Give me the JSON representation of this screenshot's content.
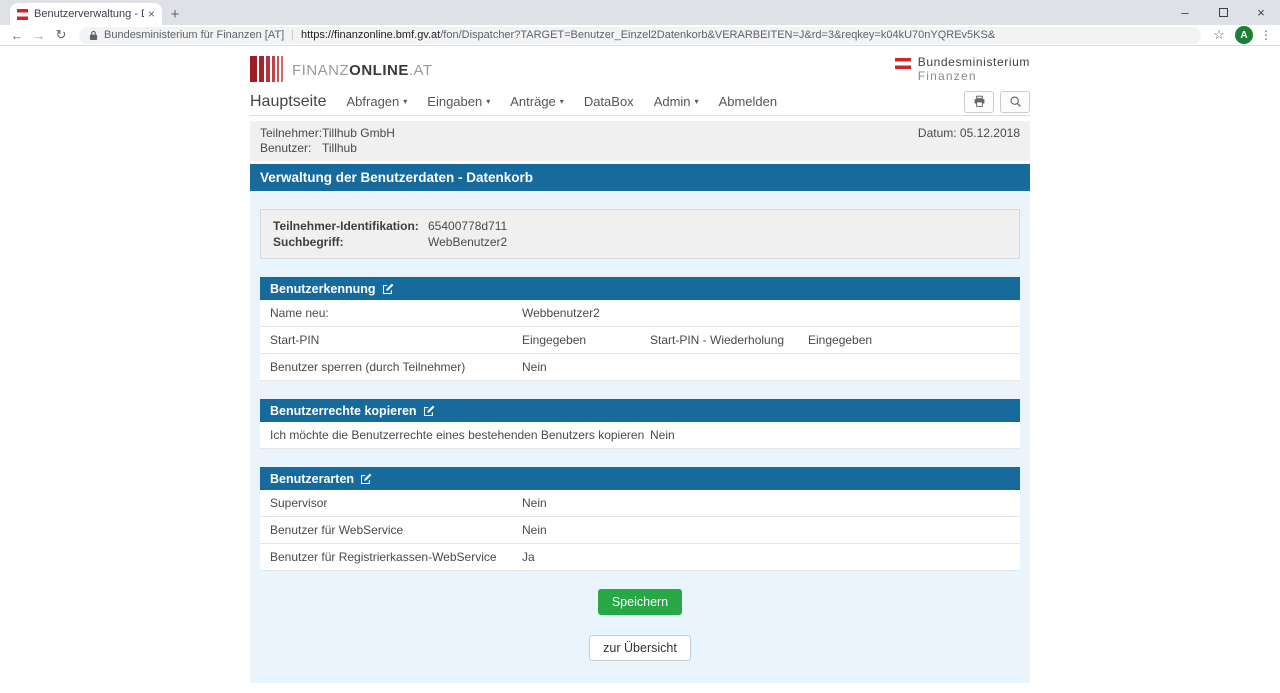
{
  "icons": {
    "back": "←",
    "forward": "→",
    "reload": "↻",
    "star": "☆",
    "menu": "⋮",
    "minimize": "–",
    "close": "×",
    "tab_close": "×",
    "new_tab": "+",
    "caret": "▾"
  },
  "browser": {
    "tab_title": "Benutzerverwaltung - Datenkorb",
    "address": {
      "security_label": "Bundesministerium für Finanzen [AT]",
      "url_domain": "https://finanzonline.bmf.gv.at",
      "url_path": "/fon/Dispatcher?TARGET=Benutzer_Einzel2Datenkorb&VERARBEITEN=J&rd=3&reqkey=k04kU70nYQREv5KS&",
      "avatar_letter": "A"
    }
  },
  "header": {
    "logo_finanz": "FINANZ",
    "logo_online": "ONLINE",
    "logo_at": ".AT",
    "ministry_line1": "Bundesministerium",
    "ministry_line2": "Finanzen"
  },
  "nav": {
    "items": [
      {
        "label": "Hauptseite"
      },
      {
        "label": "Abfragen"
      },
      {
        "label": "Eingaben"
      },
      {
        "label": "Anträge"
      },
      {
        "label": "DataBox"
      },
      {
        "label": "Admin"
      },
      {
        "label": "Abmelden"
      }
    ]
  },
  "session": {
    "teilnehmer_label": "Teilnehmer:",
    "teilnehmer_value": "Tillhub GmbH",
    "benutzer_label": "Benutzer:",
    "benutzer_value": "Tillhub",
    "date": "Datum: 05.12.2018"
  },
  "page": {
    "title": "Verwaltung der Benutzerdaten - Datenkorb"
  },
  "info_panel": {
    "rows": [
      {
        "label": "Teilnehmer-Identifikation:",
        "value": "65400778d711"
      },
      {
        "label": "Suchbegriff:",
        "value": "WebBenutzer2"
      }
    ]
  },
  "sections": {
    "benutzerkennung": {
      "title": "Benutzerkennung",
      "row_name": {
        "label": "Name neu:",
        "value": "Webbenutzer2"
      },
      "row_pin": {
        "label": "Start-PIN",
        "value": "Eingegeben",
        "label2": "Start-PIN - Wiederholung",
        "value2": "Eingegeben"
      },
      "row_sperren": {
        "label": "Benutzer sperren (durch Teilnehmer)",
        "value": "Nein"
      }
    },
    "kopieren": {
      "title": "Benutzerrechte kopieren",
      "row": {
        "label": "Ich möchte die Benutzerrechte eines bestehenden Benutzers kopieren",
        "value": "Nein"
      }
    },
    "benutzerarten": {
      "title": "Benutzerarten",
      "rows": [
        {
          "label": "Supervisor",
          "value": "Nein"
        },
        {
          "label": "Benutzer für WebService",
          "value": "Nein"
        },
        {
          "label": "Benutzer für Registrierkassen-WebService",
          "value": "Ja"
        }
      ]
    }
  },
  "buttons": {
    "save": "Speichern",
    "back": "zur Übersicht"
  },
  "colors": {
    "accent_blue": "#176a9c",
    "content_bg": "#e9f4fd",
    "save_green": "#28a745",
    "brand_red": "#d2232a"
  }
}
